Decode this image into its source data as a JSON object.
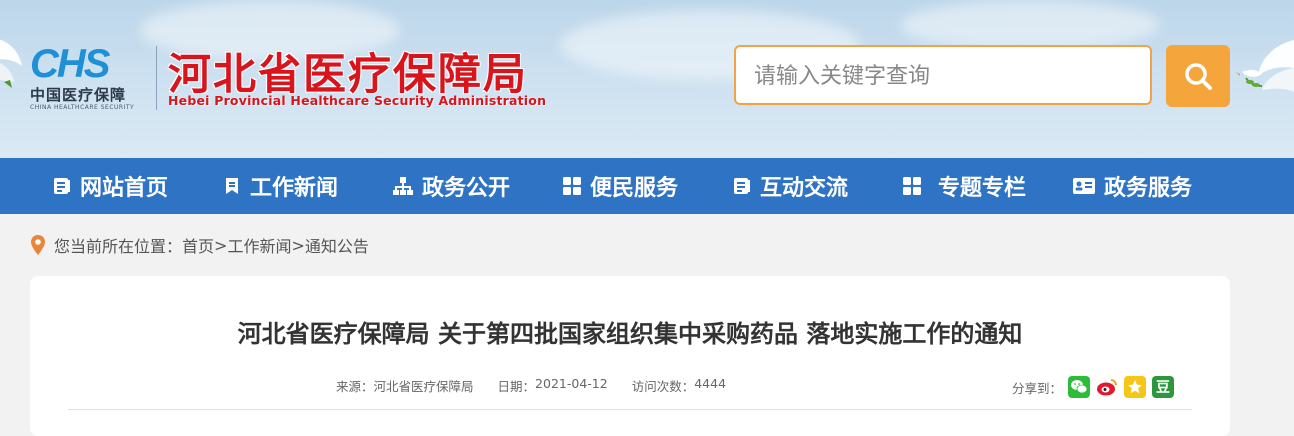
{
  "logo": {
    "mark": "CHS",
    "cn": "中国医疗保障",
    "en": "CHINA HEALTHCARE SECURITY"
  },
  "site": {
    "title": "河北省医疗保障局",
    "subtitle": "Hebei Provincial Healthcare Security Administration"
  },
  "search": {
    "placeholder": "请输入关键字查询",
    "value": ""
  },
  "nav": [
    {
      "label": "网站首页",
      "icon": "list-doc-icon"
    },
    {
      "label": "工作新闻",
      "icon": "bookmark-icon"
    },
    {
      "label": "政务公开",
      "icon": "org-chart-icon"
    },
    {
      "label": "便民服务",
      "icon": "grid-icon"
    },
    {
      "label": "互动交流",
      "icon": "list-doc-icon"
    },
    {
      "label": "专题专栏",
      "icon": "grid-icon"
    },
    {
      "label": "政务服务",
      "icon": "id-card-icon"
    }
  ],
  "breadcrumb": {
    "prefix": "您当前所在位置：",
    "items": [
      "首页",
      "工作新闻",
      "通知公告"
    ],
    "separator": ">"
  },
  "article": {
    "title": "河北省医疗保障局 关于第四批国家组织集中采购药品 落地实施工作的通知",
    "source_label": "来源：",
    "source": "河北省医疗保障局",
    "date_label": "日期：",
    "date": "2021-04-12",
    "visits_label": "访问次数：",
    "visits": "4444"
  },
  "share": {
    "label": "分享到：",
    "targets": [
      {
        "name": "wechat",
        "color": "#2dbb3a"
      },
      {
        "name": "weibo",
        "color": "#e6162d"
      },
      {
        "name": "qzone",
        "color": "#f5c518"
      },
      {
        "name": "douban",
        "color": "#2e963d",
        "glyph": "豆"
      }
    ]
  },
  "colors": {
    "nav_bg": "#2f73c4",
    "title_red": "#d8141c",
    "search_orange": "#f4a53b"
  }
}
